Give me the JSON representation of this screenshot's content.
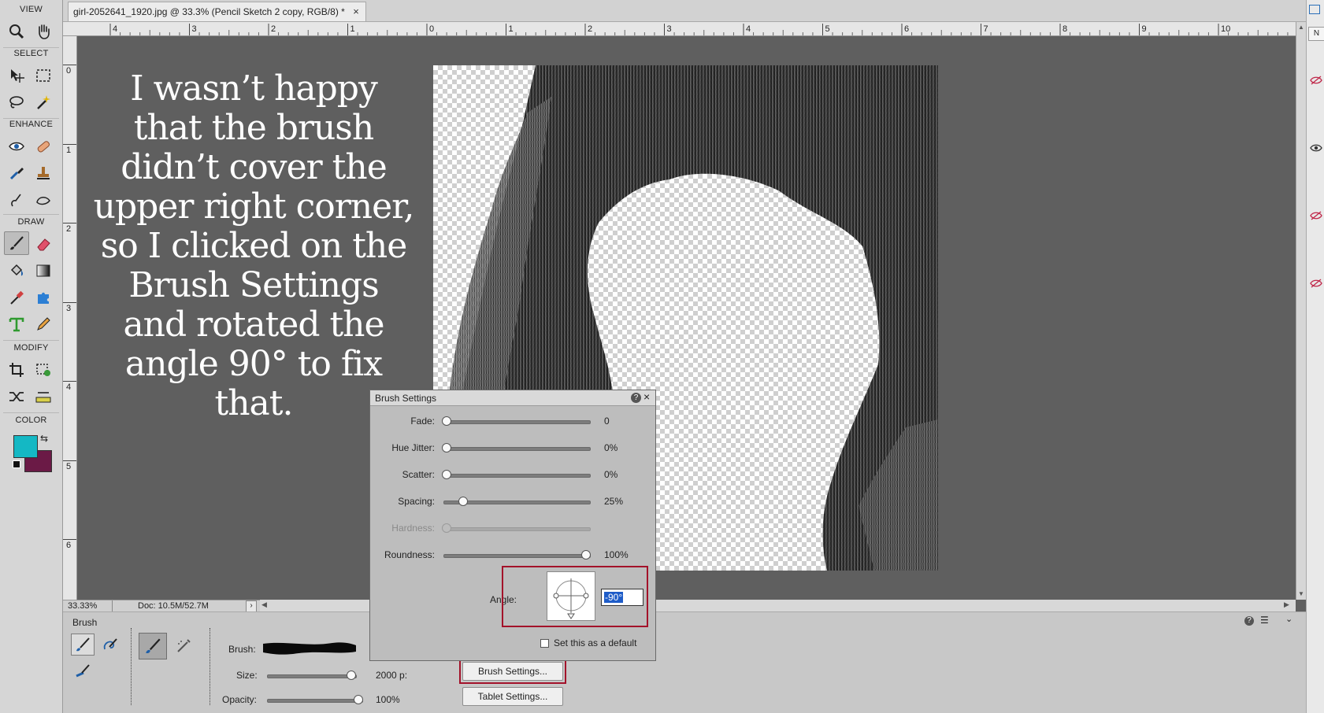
{
  "document_tab": {
    "title": "girl-2052641_1920.jpg @ 33.3% (Pencil Sketch 2 copy, RGB/8) *",
    "close": "×"
  },
  "toolbox": {
    "sections": [
      "VIEW",
      "SELECT",
      "ENHANCE",
      "DRAW",
      "MODIFY",
      "COLOR"
    ],
    "colors": {
      "foreground": "#14b8c4",
      "background": "#6b1a46"
    }
  },
  "ruler": {
    "horizontal": [
      "4",
      "3",
      "2",
      "1",
      "0",
      "1",
      "2",
      "3",
      "4",
      "5",
      "6",
      "7",
      "8",
      "9",
      "10"
    ],
    "vertical": [
      "0",
      "1",
      "2",
      "3",
      "4",
      "5",
      "6"
    ]
  },
  "caption": "I wasn’t happy that the brush didn’t cover the upper right corner, so I clicked on the Brush Settings and rotated the angle 90° to fix that.",
  "status": {
    "zoom": "33.33%",
    "doc": "Doc: 10.5M/52.7M"
  },
  "right_panel": {
    "top_label": "N"
  },
  "options": {
    "tool_name": "Brush",
    "brush_label": "Brush:",
    "size_label": "Size:",
    "size_value": "2000 p:",
    "size_fraction": 0.97,
    "opacity_label": "Opacity:",
    "opacity_value": "100%",
    "opacity_fraction": 1.0,
    "brush_settings_button": "Brush Settings...",
    "tablet_settings_button": "Tablet Settings..."
  },
  "dialog": {
    "title": "Brush Settings",
    "rows": [
      {
        "label": "Fade:",
        "value": "0",
        "fraction": 0.0,
        "disabled": false
      },
      {
        "label": "Hue Jitter:",
        "value": "0%",
        "fraction": 0.0,
        "disabled": false
      },
      {
        "label": "Scatter:",
        "value": "0%",
        "fraction": 0.0,
        "disabled": false
      },
      {
        "label": "Spacing:",
        "value": "25%",
        "fraction": 0.12,
        "disabled": false
      },
      {
        "label": "Hardness:",
        "value": "",
        "fraction": 0.0,
        "disabled": true
      },
      {
        "label": "Roundness:",
        "value": "100%",
        "fraction": 1.0,
        "disabled": false
      }
    ],
    "angle_label": "Angle:",
    "angle_value": "-90°",
    "default_checkbox_label": "Set this as a default"
  }
}
